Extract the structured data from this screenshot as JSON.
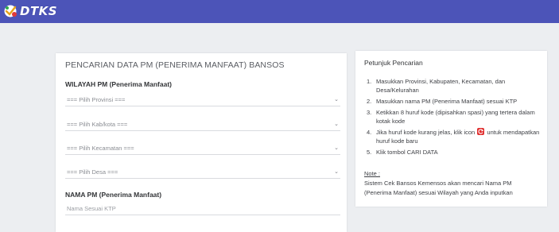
{
  "header": {
    "logo_text": "DTKS",
    "colors": {
      "bar": "#4c54b8"
    }
  },
  "form": {
    "title": "PENCARIAN DATA PM (PENERIMA MANFAAT) BANSOS",
    "wilayah_label": "WILAYAH PM (Penerima Manfaat)",
    "selects": {
      "provinsi": "=== Pilih Provinsi ===",
      "kabkota": "=== Pilih Kab/kota ===",
      "kecamatan": "=== Pilih Kecamatan ===",
      "desa": "=== Pilih Desa ==="
    },
    "nama_label": "NAMA PM (Penerima Manfaat)",
    "nama_placeholder": "Nama Sesuai KTP"
  },
  "guide": {
    "title": "Petunjuk Pencarian",
    "items": [
      "Masukkan Provinsi, Kabupaten, Kecamatan, dan Desa/Kelurahan",
      "Masukkan nama PM (Penerima Manfaat) sesuai KTP",
      "Ketikkan 8 huruf kode (dipisahkan spasi) yang tertera dalam kotak kode",
      "Jika huruf kode kurang jelas, klik icon",
      "untuk mendapatkan huruf kode baru",
      "Klik tombol CARI DATA"
    ],
    "nums": [
      "1.",
      "2.",
      "3.",
      "4.",
      "5."
    ],
    "note_title": "Note :",
    "note_text": "Sistem Cek Bansos Kemensos akan mencari Nama PM (Penerima Manfaat) sesuai Wilayah yang Anda inputkan"
  }
}
